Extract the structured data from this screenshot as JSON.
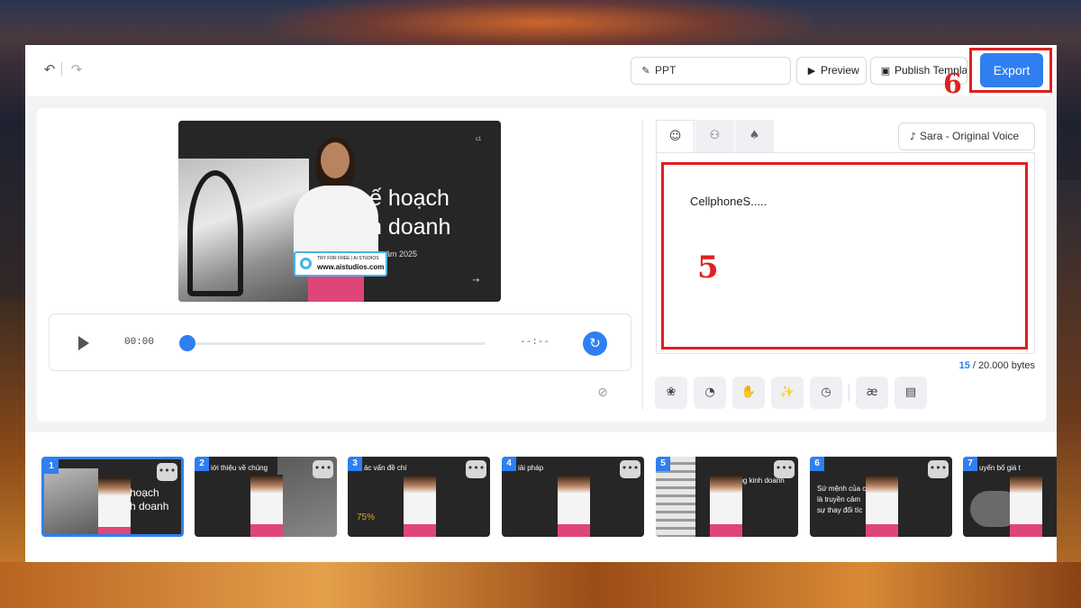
{
  "colors": {
    "accent": "#2f7ff0",
    "annotation_red": "#e0201f"
  },
  "toolbar": {
    "undo_icon": "undo-icon",
    "redo_icon": "redo-icon",
    "ppt_label": "PPT",
    "preview_label": "Preview",
    "publish_label": "Publish Template",
    "export_label": "Export"
  },
  "annotations": {
    "export_number": "6",
    "script_number": "5"
  },
  "stage": {
    "title": "ế hoạch\nh doanh",
    "subtitle": "năm 2025",
    "watermark_small": "TRY FOR FREE | AI STUDIOS",
    "watermark_url": "www.aistudios.com"
  },
  "player": {
    "current_time": "00:00",
    "end_time": "--:--"
  },
  "voice": {
    "label": "Sara - Original Voice"
  },
  "script": {
    "text": "CellphoneS....."
  },
  "counter": {
    "current": "15",
    "total": " / 20.000 bytes"
  },
  "tools": [
    "openai-icon",
    "speed-icon",
    "gesture-icon",
    "magic-icon",
    "clock-icon",
    "ae-icon",
    "subtitle-icon"
  ],
  "ae_glyph": "æ",
  "scenes": [
    {
      "number": "1",
      "title": "hoạch\nh doanh",
      "more": "•••"
    },
    {
      "number": "2",
      "title": "iới thiệu về chúng",
      "more": "•••"
    },
    {
      "number": "3",
      "title": "ác vấn đề chí",
      "more": "•••",
      "stat": "75%"
    },
    {
      "number": "4",
      "title": "iải pháp",
      "more": "•••"
    },
    {
      "number": "5",
      "title": "ổng kinh doanh",
      "more": "•••"
    },
    {
      "number": "6",
      "title": "Sứ mệnh của ch\nlà truyền cảm\nsự thay đổi tíc",
      "more": "•••"
    },
    {
      "number": "7",
      "title": "uyến bố giá t",
      "more": "•••"
    }
  ]
}
